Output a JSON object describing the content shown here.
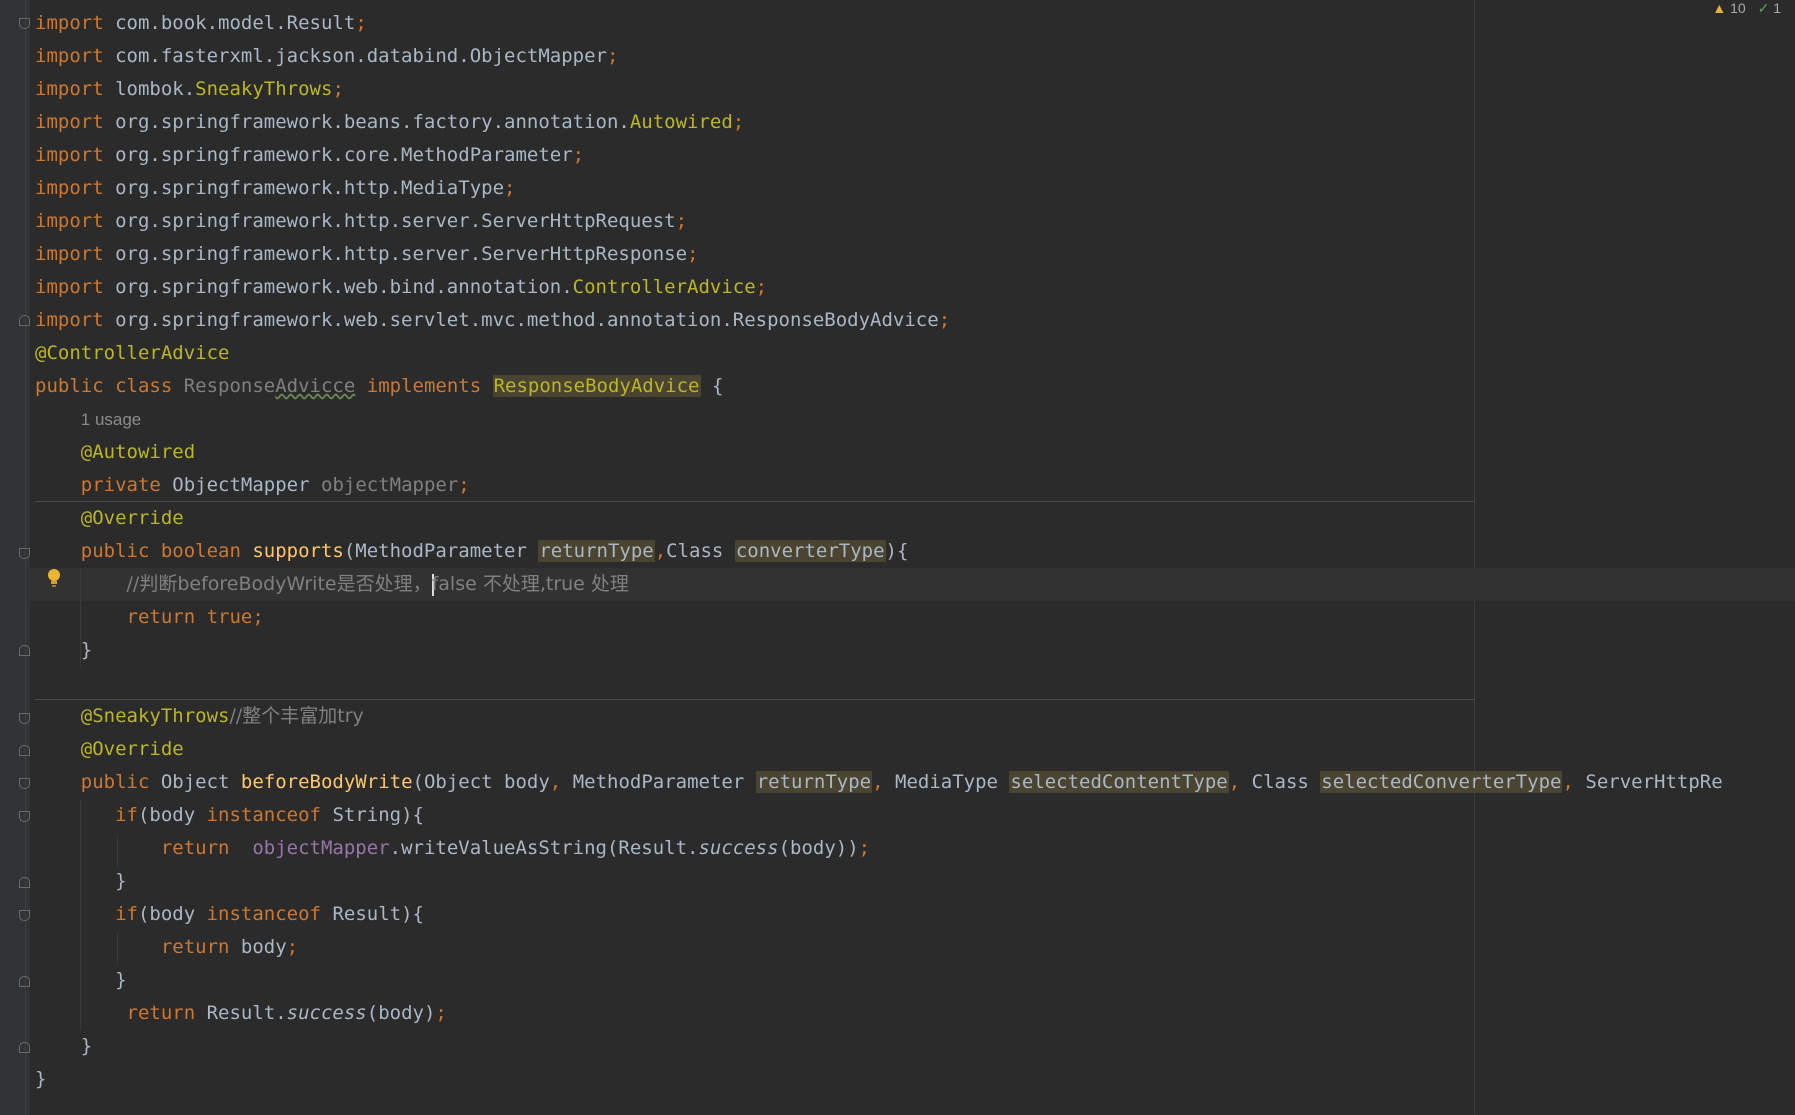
{
  "editor": {
    "lines": [
      [
        {
          "t": "import",
          "c": "kw"
        },
        {
          "t": " com.book.model.Result",
          "c": "pkg"
        },
        {
          "t": ";",
          "c": "semi"
        }
      ],
      [
        {
          "t": "import",
          "c": "kw"
        },
        {
          "t": " com.fasterxml.jackson.databind.ObjectMapper",
          "c": "pkg"
        },
        {
          "t": ";",
          "c": "semi"
        }
      ],
      [
        {
          "t": "import",
          "c": "kw"
        },
        {
          "t": " lombok.",
          "c": "pkg"
        },
        {
          "t": "SneakyThrows",
          "c": "yellowcls"
        },
        {
          "t": ";",
          "c": "semi"
        }
      ],
      [
        {
          "t": "import",
          "c": "kw"
        },
        {
          "t": " org.springframework.beans.factory.annotation.",
          "c": "pkg"
        },
        {
          "t": "Autowired",
          "c": "yellowcls"
        },
        {
          "t": ";",
          "c": "semi"
        }
      ],
      [
        {
          "t": "import",
          "c": "kw"
        },
        {
          "t": " org.springframework.core.MethodParameter",
          "c": "pkg"
        },
        {
          "t": ";",
          "c": "semi"
        }
      ],
      [
        {
          "t": "import",
          "c": "kw"
        },
        {
          "t": " org.springframework.http.MediaType",
          "c": "pkg"
        },
        {
          "t": ";",
          "c": "semi"
        }
      ],
      [
        {
          "t": "import",
          "c": "kw"
        },
        {
          "t": " org.springframework.http.server.ServerHttpRequest",
          "c": "pkg"
        },
        {
          "t": ";",
          "c": "semi"
        }
      ],
      [
        {
          "t": "import",
          "c": "kw"
        },
        {
          "t": " org.springframework.http.server.ServerHttpResponse",
          "c": "pkg"
        },
        {
          "t": ";",
          "c": "semi"
        }
      ],
      [
        {
          "t": "import",
          "c": "kw"
        },
        {
          "t": " org.springframework.web.bind.annotation.",
          "c": "pkg"
        },
        {
          "t": "ControllerAdvice",
          "c": "yellowcls"
        },
        {
          "t": ";",
          "c": "semi"
        }
      ],
      [
        {
          "t": "import",
          "c": "kw"
        },
        {
          "t": " org.springframework.web.servlet.mvc.method.annotation.ResponseBodyAdvice",
          "c": "pkg"
        },
        {
          "t": ";",
          "c": "semi"
        }
      ],
      [
        {
          "t": "@ControllerAdvice",
          "c": "ann"
        }
      ],
      [
        {
          "t": "public class ",
          "c": "kw"
        },
        {
          "t": "Response",
          "c": "unused"
        },
        {
          "t": "Advicce",
          "c": "unused squiggle"
        },
        {
          "t": " implements ",
          "c": "kw"
        },
        {
          "t": "ResponseBodyAdvice",
          "c": "yellowcls hl"
        },
        {
          "t": " {",
          "c": "pkg"
        }
      ],
      [
        {
          "t": "    ",
          "c": "pkg"
        },
        {
          "t": "1 usage",
          "c": "hint"
        }
      ],
      [
        {
          "t": "    @Autowired",
          "c": "ann"
        }
      ],
      [
        {
          "t": "    private ",
          "c": "kw"
        },
        {
          "t": "ObjectMapper ",
          "c": "pkg"
        },
        {
          "t": "objectMapper",
          "c": "unused"
        },
        {
          "t": ";",
          "c": "semi"
        }
      ],
      [
        {
          "t": "    @Override",
          "c": "ann"
        }
      ],
      [
        {
          "t": "    public boolean ",
          "c": "kw"
        },
        {
          "t": "supports",
          "c": "fn"
        },
        {
          "t": "(MethodParameter ",
          "c": "pkg"
        },
        {
          "t": "returnType",
          "c": "pkg hl"
        },
        {
          "t": ",",
          "c": "semi"
        },
        {
          "t": "Class ",
          "c": "pkg"
        },
        {
          "t": "converterType",
          "c": "pkg hl"
        },
        {
          "t": "){",
          "c": "pkg"
        }
      ],
      [
        {
          "t": "        ",
          "c": "pkg"
        },
        {
          "t": "//判断beforeBodyWrite是否处理，",
          "c": "cmt"
        },
        {
          "t": "CARET",
          "c": "caret"
        },
        {
          "t": "false 不处理,true 处理",
          "c": "cmt"
        }
      ],
      [
        {
          "t": "        return true",
          "c": "kw"
        },
        {
          "t": ";",
          "c": "semi"
        }
      ],
      [
        {
          "t": "    }",
          "c": "pkg"
        }
      ],
      [
        {
          "t": "",
          "c": "pkg"
        }
      ],
      [
        {
          "t": "    @SneakyThrows",
          "c": "ann"
        },
        {
          "t": "//整个丰富加try",
          "c": "cmt"
        }
      ],
      [
        {
          "t": "    @Override",
          "c": "ann"
        }
      ],
      [
        {
          "t": "    public ",
          "c": "kw"
        },
        {
          "t": "Object ",
          "c": "pkg"
        },
        {
          "t": "beforeBodyWrite",
          "c": "fn"
        },
        {
          "t": "(Object body",
          "c": "pkg"
        },
        {
          "t": ", ",
          "c": "semi"
        },
        {
          "t": "MethodParameter ",
          "c": "pkg"
        },
        {
          "t": "returnType",
          "c": "pkg hl"
        },
        {
          "t": ", ",
          "c": "semi"
        },
        {
          "t": "MediaType ",
          "c": "pkg"
        },
        {
          "t": "selectedContentType",
          "c": "pkg hl"
        },
        {
          "t": ", ",
          "c": "semi"
        },
        {
          "t": "Class ",
          "c": "pkg"
        },
        {
          "t": "selectedConverterType",
          "c": "pkg hl"
        },
        {
          "t": ", ",
          "c": "semi"
        },
        {
          "t": "ServerHttpRe",
          "c": "pkg"
        }
      ],
      [
        {
          "t": "       if",
          "c": "kw"
        },
        {
          "t": "(body ",
          "c": "pkg"
        },
        {
          "t": "instanceof ",
          "c": "kw"
        },
        {
          "t": "String){",
          "c": "pkg"
        }
      ],
      [
        {
          "t": "           return  ",
          "c": "kw"
        },
        {
          "t": "objectMapper",
          "c": "field"
        },
        {
          "t": ".writeValueAsString(Result.",
          "c": "pkg"
        },
        {
          "t": "success",
          "c": "pkg italic"
        },
        {
          "t": "(body))",
          "c": "pkg"
        },
        {
          "t": ";",
          "c": "semi"
        }
      ],
      [
        {
          "t": "       }",
          "c": "pkg"
        }
      ],
      [
        {
          "t": "       if",
          "c": "kw"
        },
        {
          "t": "(body ",
          "c": "pkg"
        },
        {
          "t": "instanceof ",
          "c": "kw"
        },
        {
          "t": "Result){",
          "c": "pkg"
        }
      ],
      [
        {
          "t": "           return ",
          "c": "kw"
        },
        {
          "t": "body",
          "c": "pkg"
        },
        {
          "t": ";",
          "c": "semi"
        }
      ],
      [
        {
          "t": "       }",
          "c": "pkg"
        }
      ],
      [
        {
          "t": "        return ",
          "c": "kw"
        },
        {
          "t": "Result.",
          "c": "pkg"
        },
        {
          "t": "success",
          "c": "pkg italic"
        },
        {
          "t": "(body)",
          "c": "pkg"
        },
        {
          "t": ";",
          "c": "semi"
        }
      ],
      [
        {
          "t": "    }",
          "c": "pkg"
        }
      ],
      [
        {
          "t": "}",
          "c": "pkg"
        }
      ]
    ]
  },
  "toolbar": {
    "warnings_count": "10",
    "other_count": "1"
  }
}
